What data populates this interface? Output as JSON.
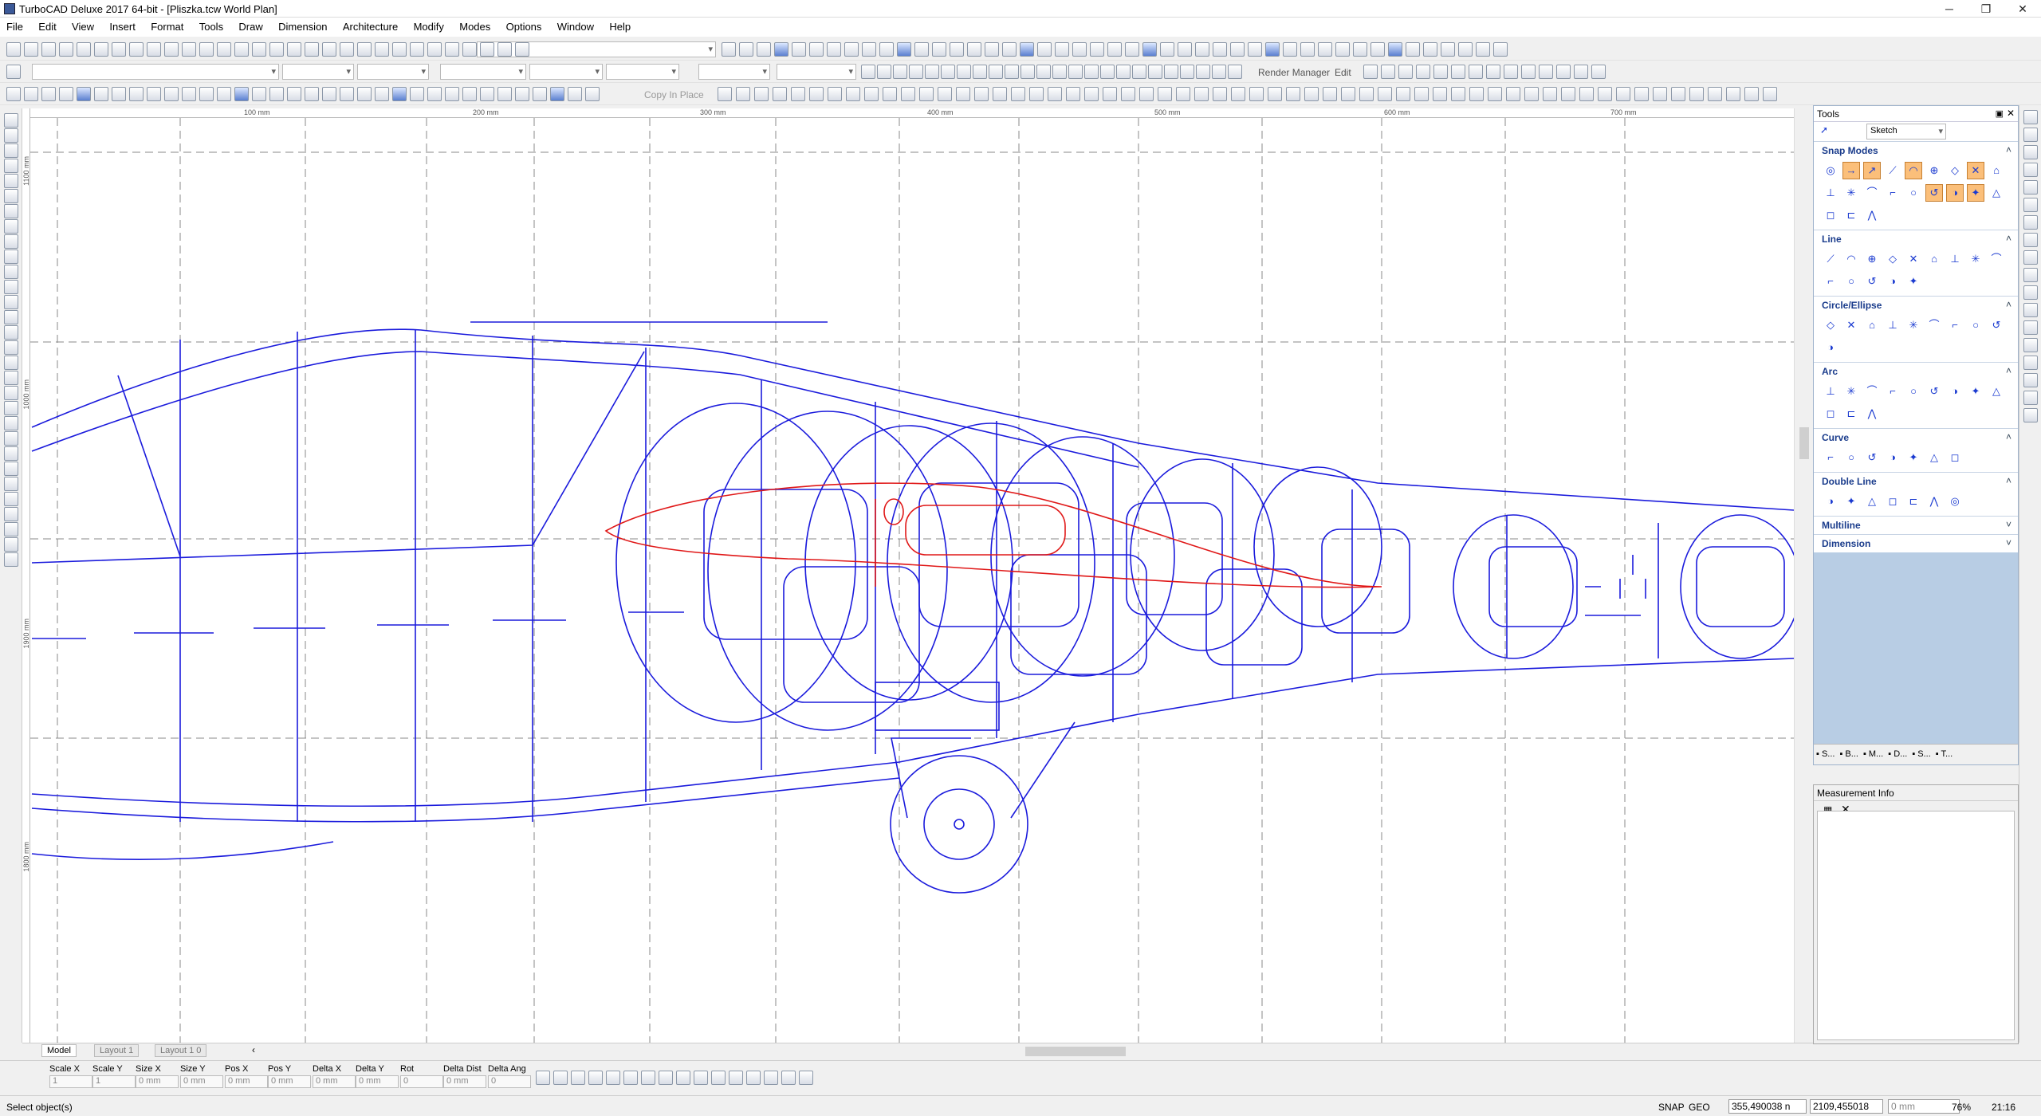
{
  "window": {
    "title": "TurboCAD Deluxe 2017 64-bit - [Pliszka.tcw World Plan]",
    "minimize": "─",
    "restore": "❐",
    "close": "✕"
  },
  "menu": [
    "File",
    "Edit",
    "View",
    "Insert",
    "Format",
    "Tools",
    "Draw",
    "Dimension",
    "Architecture",
    "Modify",
    "Modes",
    "Options",
    "Window",
    "Help"
  ],
  "toolbar": {
    "render_manager": "Render Manager",
    "edit": "Edit",
    "copy_in_place": "Copy In Place"
  },
  "ruler": {
    "top_labels": [
      "100 mm",
      "200 mm",
      "300 mm",
      "400 mm",
      "500 mm",
      "600 mm",
      "700 mm"
    ],
    "left_labels": [
      "1100 mm",
      "1000 mm",
      "1900 mm",
      "1800 mm"
    ]
  },
  "tabs": [
    "Model",
    "Layout 1",
    "Layout 1 0"
  ],
  "inspector": [
    {
      "label": "Scale X",
      "value": "1"
    },
    {
      "label": "Scale Y",
      "value": "1"
    },
    {
      "label": "Size X",
      "value": "0 mm"
    },
    {
      "label": "Size Y",
      "value": "0 mm"
    },
    {
      "label": "Pos X",
      "value": "0 mm"
    },
    {
      "label": "Pos Y",
      "value": "0 mm"
    },
    {
      "label": "Delta X",
      "value": "0 mm"
    },
    {
      "label": "Delta Y",
      "value": "0 mm"
    },
    {
      "label": "Rot",
      "value": "0"
    },
    {
      "label": "Delta Dist",
      "value": "0 mm"
    },
    {
      "label": "Delta Ang",
      "value": "0"
    }
  ],
  "status": {
    "message": "Select object(s)",
    "snap": "SNAP",
    "geo": "GEO",
    "x_coord": "355,490038 n",
    "y_coord": "2109,455018",
    "third": "0 mm",
    "zoom": "76%",
    "time": "21:16"
  },
  "tools_palette": {
    "title": "Tools",
    "mode": "Sketch",
    "sections": [
      {
        "name": "Snap Modes",
        "icons": 21
      },
      {
        "name": "Line",
        "icons": 14
      },
      {
        "name": "Circle/Ellipse",
        "icons": 10
      },
      {
        "name": "Arc",
        "icons": 12
      },
      {
        "name": "Curve",
        "icons": 7
      },
      {
        "name": "Double Line",
        "icons": 7
      },
      {
        "name": "Multiline",
        "icons": 0
      },
      {
        "name": "Dimension",
        "icons": 0
      }
    ],
    "bottom_tabs": [
      "S...",
      "B...",
      "M...",
      "D...",
      "S...",
      "T..."
    ]
  },
  "measurement_info": {
    "title": "Measurement Info"
  },
  "colors": {
    "drawing_line": "#1b1bdc",
    "wing_profile": "#e01818",
    "snap_active": "#fbbf7a"
  }
}
